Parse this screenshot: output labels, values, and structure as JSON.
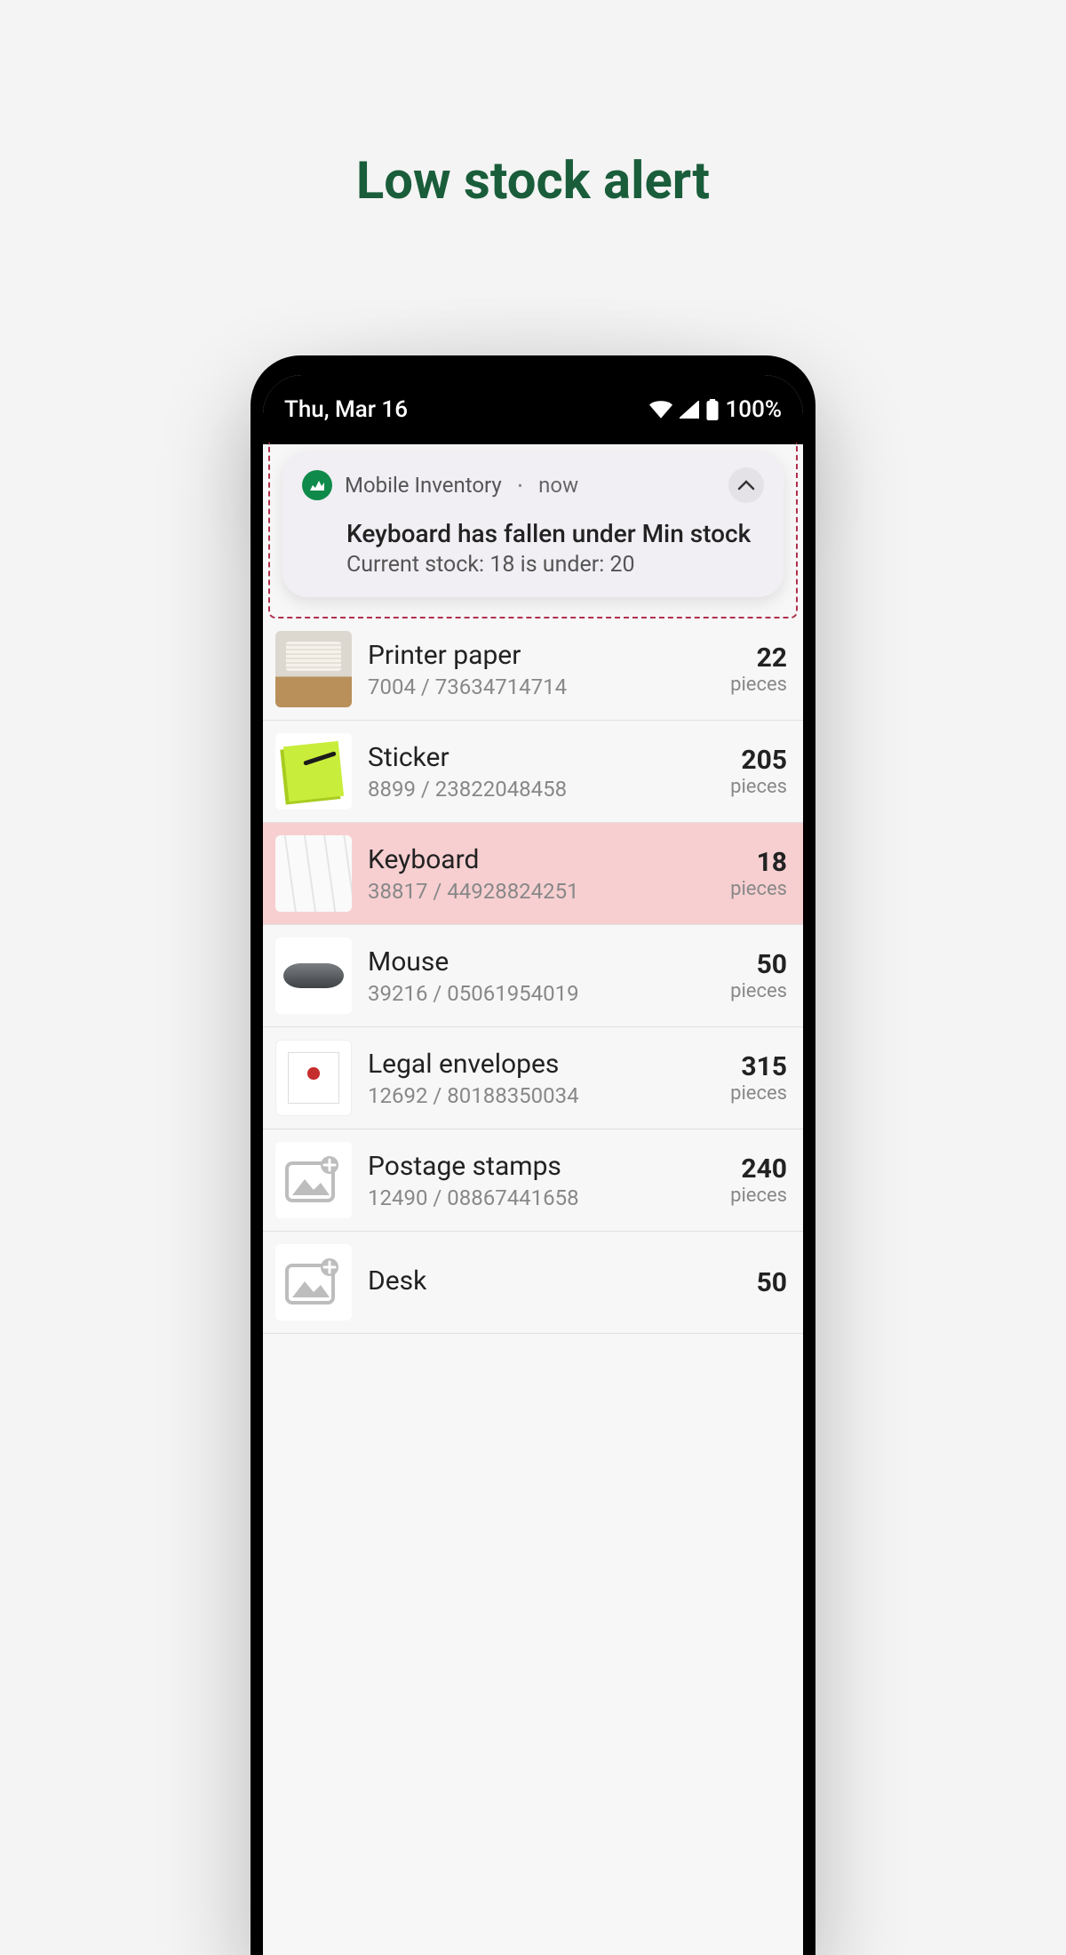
{
  "page": {
    "title": "Low stock alert"
  },
  "status_bar": {
    "date": "Thu, Mar 16",
    "battery": "100%"
  },
  "notification": {
    "app_name": "Mobile Inventory",
    "time": "now",
    "title": "Keyboard has fallen under Min stock",
    "body": "Current stock: 18 is under: 20"
  },
  "items": [
    {
      "name": "Printer paper",
      "code": "7004 / 73634714714",
      "qty": "22",
      "unit": "pieces",
      "thumb": "paper",
      "highlight": false
    },
    {
      "name": "Sticker",
      "code": "8899 / 23822048458",
      "qty": "205",
      "unit": "pieces",
      "thumb": "sticker",
      "highlight": false
    },
    {
      "name": "Keyboard",
      "code": "38817 / 44928824251",
      "qty": "18",
      "unit": "pieces",
      "thumb": "keyboard",
      "highlight": true
    },
    {
      "name": "Mouse",
      "code": "39216 / 05061954019",
      "qty": "50",
      "unit": "pieces",
      "thumb": "mouse",
      "highlight": false
    },
    {
      "name": "Legal envelopes",
      "code": "12692 / 80188350034",
      "qty": "315",
      "unit": "pieces",
      "thumb": "envelope",
      "highlight": false
    },
    {
      "name": "Postage stamps",
      "code": "12490 / 08867441658",
      "qty": "240",
      "unit": "pieces",
      "thumb": "placeholder",
      "highlight": false
    },
    {
      "name": "Desk",
      "code": "",
      "qty": "50",
      "unit": "",
      "thumb": "placeholder",
      "highlight": false
    }
  ]
}
